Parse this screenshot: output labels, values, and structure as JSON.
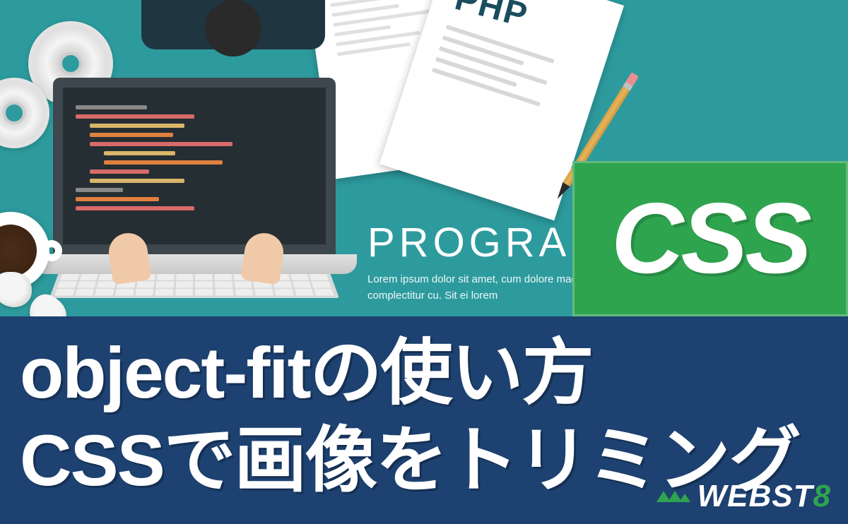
{
  "illustration": {
    "php_label": "PHP",
    "title": "PROGRAMMING",
    "subtitle_line1": "Lorem ipsum dolor sit amet, cum dolore magna aliqua",
    "subtitle_line2": "complectitur cu. Sit ei lorem"
  },
  "badge": {
    "label": "CSS"
  },
  "banner": {
    "line1": "object-fitの使い方",
    "line2": "CSSで画像をトリミング"
  },
  "logo": {
    "brand_prefix": "WEBST",
    "brand_suffix": "8"
  },
  "colors": {
    "teal_bg": "#2d9b9e",
    "badge_green": "#2fa44f",
    "banner_blue": "#1d4170"
  }
}
